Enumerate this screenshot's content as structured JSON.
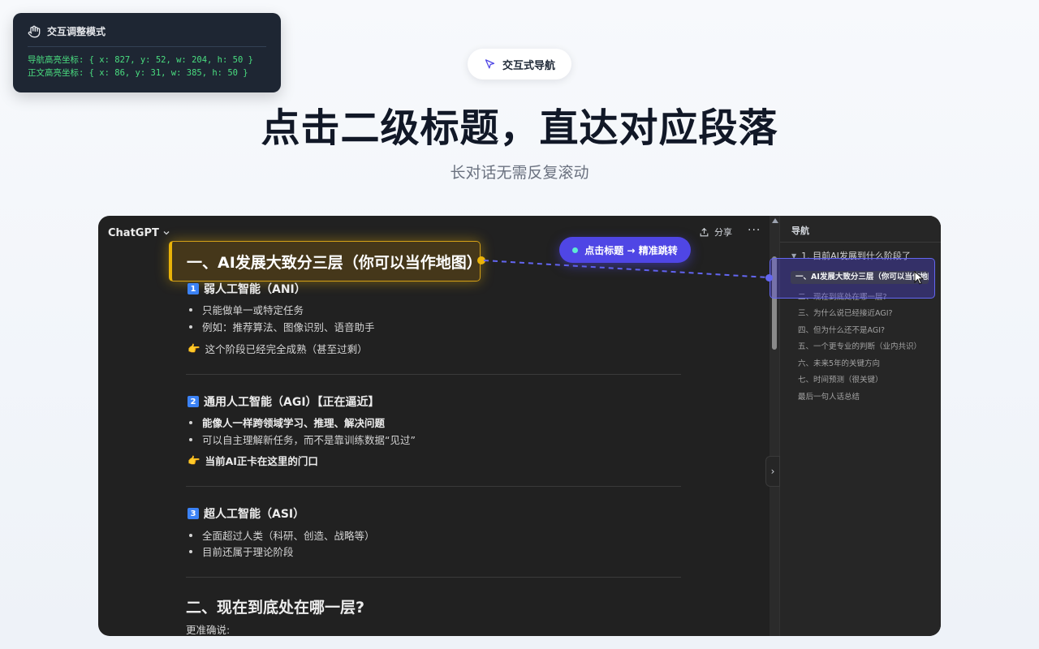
{
  "debug": {
    "title": "交互调整模式",
    "nav_coords": "导航高亮坐标: { x: 827, y: 52, w: 204, h: 50 }",
    "body_coords": "正文高亮坐标: { x: 86, y: 31, w: 385, h: 50 }"
  },
  "hero": {
    "pill": "交互式导航",
    "title": "点击二级标题，直达对应段落",
    "subtitle": "长对话无需反复滚动"
  },
  "app": {
    "model": "ChatGPT",
    "share": "分享",
    "more": "···",
    "jump_badge": "点击标题 → 精准跳转",
    "content": {
      "section1_title": "一、AI发展大致分三层（你可以当作地图）",
      "ani": {
        "num": "1",
        "title": "弱人工智能（ANI）",
        "b1": "只能做单一或特定任务",
        "b2": "例如：推荐算法、图像识别、语音助手",
        "note": "这个阶段已经完全成熟（甚至过剩）"
      },
      "agi": {
        "num": "2",
        "title": "通用人工智能（AGI）【正在逼近】",
        "b1": "能像人一样跨领域学习、推理、解决问题",
        "b2": "可以自主理解新任务，而不是靠训练数据“见过”",
        "note": "当前AI正卡在这里的门口"
      },
      "asi": {
        "num": "3",
        "title": "超人工智能（ASI）",
        "b1": "全面超过人类（科研、创造、战略等）",
        "b2": "目前还属于理论阶段"
      },
      "section2_title": "二、现在到底处在哪一层?",
      "section2_text": "更准确说:"
    },
    "nav": {
      "title": "导航",
      "group": "1. 目前AI发展到什么阶段了",
      "active": "一、AI发展大致分三层（你可以当作地图）",
      "items": [
        "二、现在到底处在哪一层?",
        "三、为什么说已经接近AGI?",
        "四、但为什么还不是AGI?",
        "五、一个更专业的判断（业内共识）",
        "六、未来5年的关键方向",
        "七、时间预测（很关键）",
        "最后一句人话总结"
      ]
    }
  },
  "colors": {
    "accent": "#4f46e5",
    "highlight": "#eab308",
    "code_green": "#4ade80",
    "app_bg": "#212121"
  }
}
